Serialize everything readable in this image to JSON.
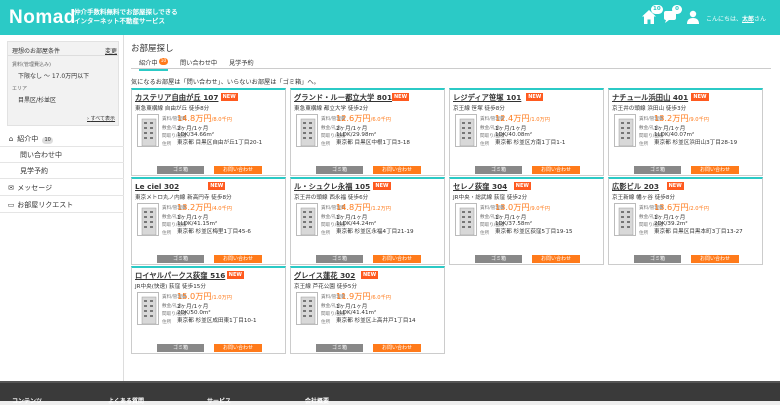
{
  "header": {
    "logo": "Nomad",
    "tagline_1": "仲介手数料無料でお部屋探しできる",
    "tagline_2": "インターネット不動産サービス",
    "badge_favorites": "10",
    "badge_messages": "0",
    "greeting_prefix": "こんにちは、",
    "user_name": "太郎",
    "greeting_suffix": "さん"
  },
  "sidebar": {
    "condition_title": "理想のお部屋条件",
    "change_label": "変更",
    "rent_label": "賃料(管理費込み)",
    "rent_value": "下限なし ～ 17.0万円以下",
    "area_label": "エリア",
    "area_value": "目黒区/杉並区",
    "show_all": "すべて表示",
    "items": [
      {
        "label": "紹介中",
        "count": "10"
      },
      {
        "label": "問い合わせ中"
      },
      {
        "label": "見学予約"
      },
      {
        "label": "メッセージ"
      },
      {
        "label": "お部屋リクエスト"
      }
    ]
  },
  "main": {
    "title": "お部屋探し",
    "tabs": [
      {
        "label": "紹介中",
        "count": "10"
      },
      {
        "label": "問い合わせ中"
      },
      {
        "label": "見学予約"
      }
    ],
    "note": "気になるお部屋は「問い合わせ」、いらないお部屋は「ゴミ箱」へ。",
    "field_labels": {
      "rent": "賃料/管理費",
      "deposit": "敷金/礼金",
      "layout": "間取り/面積",
      "address": "住所"
    },
    "trash_label": "ゴミ箱",
    "inquiry_label": "お問い合わせ",
    "new_label": "NEW"
  },
  "listings": [
    {
      "name": "カステリア自由が丘 107",
      "station": "東急東横線 自由が丘 徒歩8分",
      "price": "14.8万円",
      "fee": "/8.0千円",
      "deposit": "2ヶ月/1ヶ月",
      "layout": "1DK/34.66m²",
      "address": "東京都 目黒区自由が丘1丁目20-1"
    },
    {
      "name": "グランド・ルー都立大学 801",
      "station": "東急東横線 都立大学 徒歩2分",
      "price": "12.6万円",
      "fee": "/6.0千円",
      "deposit": "2ヶ月/1ヶ月",
      "layout": "1LDK/29.98m²",
      "address": "東京都 目黒区中根1丁目3-18"
    },
    {
      "name": "レジディア笹塚 101",
      "station": "京王線 笹塚 徒歩8分",
      "price": "12.4万円",
      "fee": "/1.0万円",
      "deposit": "1ヶ月/1ヶ月",
      "layout": "1DK/40.08m²",
      "address": "東京都 杉並区方南1丁目1-1"
    },
    {
      "name": "ナチュール浜田山 401",
      "station": "京王井の頭線 浜田山 徒歩3分",
      "price": "13.2万円",
      "fee": "/9.0千円",
      "deposit": "1ヶ月/1ヶ月",
      "layout": "1LDK/40.07m²",
      "address": "東京都 杉並区浜田山3丁目28-19"
    },
    {
      "name": "Le ciel 302",
      "station": "東京メトロ丸ノ内線 新高円寺 徒歩8分",
      "price": "13.2万円",
      "fee": "/4.0千円",
      "deposit": "1ヶ月/1ヶ月",
      "layout": "1LDK/41.15m²",
      "address": "東京都 杉並区梅里1丁目45-6"
    },
    {
      "name": "ル・シュクレ永福 105",
      "station": "京王井の頭線 西永福 徒歩6分",
      "price": "14.8万円",
      "fee": "/1.2万円",
      "deposit": "1ヶ月/1ヶ月",
      "layout": "1LDK/44.24m²",
      "address": "東京都 杉並区永福4丁目21-19"
    },
    {
      "name": "セレノ荻窪 304",
      "station": "JR中央・総武線 荻窪 徒歩2分",
      "price": "13.0万円",
      "fee": "/9.0千円",
      "deposit": "1ヶ月/1ヶ月",
      "layout": "1DK/37.58m²",
      "address": "東京都 杉並区荻窪5丁目19-15"
    },
    {
      "name": "広影ビル 203",
      "station": "京王新線 幡ヶ谷 徒歩8分",
      "price": "13.6万円",
      "fee": "/2.0千円",
      "deposit": "1ヶ月/1ヶ月",
      "layout": "2DK/39.2m²",
      "address": "東京都 目黒区目黒本町3丁目13-27"
    },
    {
      "name": "ロイヤルパークス荻窪 516",
      "station": "JR中央(快速) 荻窪 徒歩15分",
      "price": "15.0万円",
      "fee": "/1.0万円",
      "deposit": "2ヶ月/1ヶ月",
      "layout": "2DK/50.0m²",
      "address": "東京都 杉並区成田東1丁目10-1"
    },
    {
      "name": "グレイス蓮花 302",
      "station": "京王線 芦花公園 徒歩5分",
      "price": "11.9万円",
      "fee": "/6.0千円",
      "deposit": "1ヶ月/1ヶ月",
      "layout": "1LDK/41.41m²",
      "address": "東京都 杉並区上高井戸1丁目14"
    }
  ],
  "footer": {
    "links": [
      "コンテンツ",
      "よくある質問",
      "サービス",
      "会社概要"
    ]
  },
  "colors": {
    "brand": "#2bcac6",
    "accent": "#ff7a1a",
    "new_badge": "#ff5a1f"
  }
}
